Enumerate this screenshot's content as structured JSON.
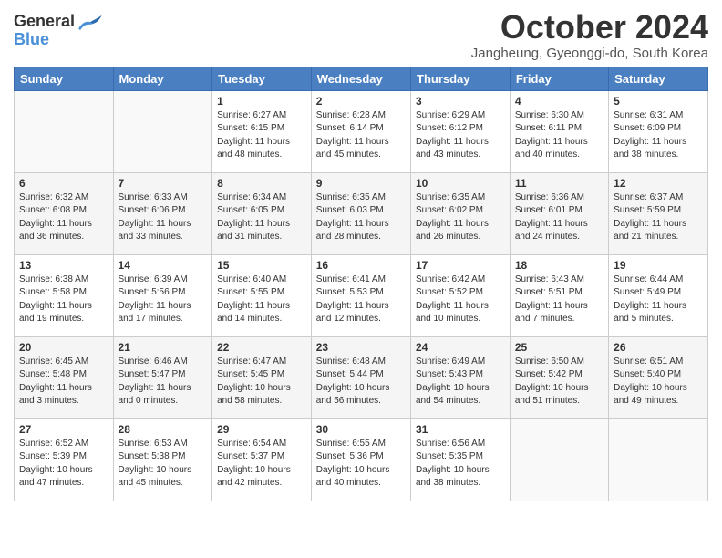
{
  "logo": {
    "general": "General",
    "blue": "Blue"
  },
  "title": "October 2024",
  "subtitle": "Jangheung, Gyeonggi-do, South Korea",
  "days_of_week": [
    "Sunday",
    "Monday",
    "Tuesday",
    "Wednesday",
    "Thursday",
    "Friday",
    "Saturday"
  ],
  "weeks": [
    [
      {
        "day": "",
        "info": ""
      },
      {
        "day": "",
        "info": ""
      },
      {
        "day": "1",
        "info": "Sunrise: 6:27 AM\nSunset: 6:15 PM\nDaylight: 11 hours and 48 minutes."
      },
      {
        "day": "2",
        "info": "Sunrise: 6:28 AM\nSunset: 6:14 PM\nDaylight: 11 hours and 45 minutes."
      },
      {
        "day": "3",
        "info": "Sunrise: 6:29 AM\nSunset: 6:12 PM\nDaylight: 11 hours and 43 minutes."
      },
      {
        "day": "4",
        "info": "Sunrise: 6:30 AM\nSunset: 6:11 PM\nDaylight: 11 hours and 40 minutes."
      },
      {
        "day": "5",
        "info": "Sunrise: 6:31 AM\nSunset: 6:09 PM\nDaylight: 11 hours and 38 minutes."
      }
    ],
    [
      {
        "day": "6",
        "info": "Sunrise: 6:32 AM\nSunset: 6:08 PM\nDaylight: 11 hours and 36 minutes."
      },
      {
        "day": "7",
        "info": "Sunrise: 6:33 AM\nSunset: 6:06 PM\nDaylight: 11 hours and 33 minutes."
      },
      {
        "day": "8",
        "info": "Sunrise: 6:34 AM\nSunset: 6:05 PM\nDaylight: 11 hours and 31 minutes."
      },
      {
        "day": "9",
        "info": "Sunrise: 6:35 AM\nSunset: 6:03 PM\nDaylight: 11 hours and 28 minutes."
      },
      {
        "day": "10",
        "info": "Sunrise: 6:35 AM\nSunset: 6:02 PM\nDaylight: 11 hours and 26 minutes."
      },
      {
        "day": "11",
        "info": "Sunrise: 6:36 AM\nSunset: 6:01 PM\nDaylight: 11 hours and 24 minutes."
      },
      {
        "day": "12",
        "info": "Sunrise: 6:37 AM\nSunset: 5:59 PM\nDaylight: 11 hours and 21 minutes."
      }
    ],
    [
      {
        "day": "13",
        "info": "Sunrise: 6:38 AM\nSunset: 5:58 PM\nDaylight: 11 hours and 19 minutes."
      },
      {
        "day": "14",
        "info": "Sunrise: 6:39 AM\nSunset: 5:56 PM\nDaylight: 11 hours and 17 minutes."
      },
      {
        "day": "15",
        "info": "Sunrise: 6:40 AM\nSunset: 5:55 PM\nDaylight: 11 hours and 14 minutes."
      },
      {
        "day": "16",
        "info": "Sunrise: 6:41 AM\nSunset: 5:53 PM\nDaylight: 11 hours and 12 minutes."
      },
      {
        "day": "17",
        "info": "Sunrise: 6:42 AM\nSunset: 5:52 PM\nDaylight: 11 hours and 10 minutes."
      },
      {
        "day": "18",
        "info": "Sunrise: 6:43 AM\nSunset: 5:51 PM\nDaylight: 11 hours and 7 minutes."
      },
      {
        "day": "19",
        "info": "Sunrise: 6:44 AM\nSunset: 5:49 PM\nDaylight: 11 hours and 5 minutes."
      }
    ],
    [
      {
        "day": "20",
        "info": "Sunrise: 6:45 AM\nSunset: 5:48 PM\nDaylight: 11 hours and 3 minutes."
      },
      {
        "day": "21",
        "info": "Sunrise: 6:46 AM\nSunset: 5:47 PM\nDaylight: 11 hours and 0 minutes."
      },
      {
        "day": "22",
        "info": "Sunrise: 6:47 AM\nSunset: 5:45 PM\nDaylight: 10 hours and 58 minutes."
      },
      {
        "day": "23",
        "info": "Sunrise: 6:48 AM\nSunset: 5:44 PM\nDaylight: 10 hours and 56 minutes."
      },
      {
        "day": "24",
        "info": "Sunrise: 6:49 AM\nSunset: 5:43 PM\nDaylight: 10 hours and 54 minutes."
      },
      {
        "day": "25",
        "info": "Sunrise: 6:50 AM\nSunset: 5:42 PM\nDaylight: 10 hours and 51 minutes."
      },
      {
        "day": "26",
        "info": "Sunrise: 6:51 AM\nSunset: 5:40 PM\nDaylight: 10 hours and 49 minutes."
      }
    ],
    [
      {
        "day": "27",
        "info": "Sunrise: 6:52 AM\nSunset: 5:39 PM\nDaylight: 10 hours and 47 minutes."
      },
      {
        "day": "28",
        "info": "Sunrise: 6:53 AM\nSunset: 5:38 PM\nDaylight: 10 hours and 45 minutes."
      },
      {
        "day": "29",
        "info": "Sunrise: 6:54 AM\nSunset: 5:37 PM\nDaylight: 10 hours and 42 minutes."
      },
      {
        "day": "30",
        "info": "Sunrise: 6:55 AM\nSunset: 5:36 PM\nDaylight: 10 hours and 40 minutes."
      },
      {
        "day": "31",
        "info": "Sunrise: 6:56 AM\nSunset: 5:35 PM\nDaylight: 10 hours and 38 minutes."
      },
      {
        "day": "",
        "info": ""
      },
      {
        "day": "",
        "info": ""
      }
    ]
  ]
}
